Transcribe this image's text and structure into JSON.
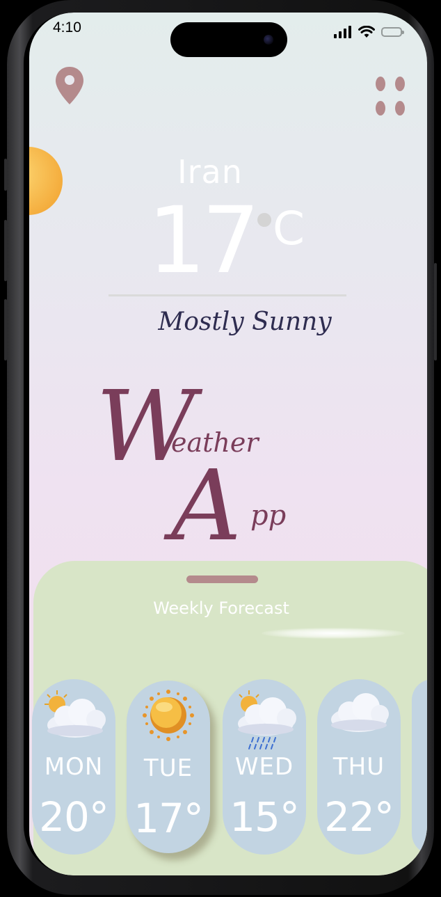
{
  "status_bar": {
    "time": "4:10"
  },
  "location": {
    "country": "Iran",
    "temperature": "17",
    "unit": "C",
    "condition": "Mostly Sunny"
  },
  "branding": {
    "title_line1_cap": "W",
    "title_line1_rest": "eather",
    "title_line2_cap": "A",
    "title_line2_rest": "pp"
  },
  "forecast": {
    "title": "Weekly Forecast",
    "days": [
      {
        "day": "MON",
        "temp": "20°",
        "icon": "partly-cloudy-icon"
      },
      {
        "day": "TUE",
        "temp": "17°",
        "icon": "sun-icon"
      },
      {
        "day": "WED",
        "temp": "15°",
        "icon": "rain-icon"
      },
      {
        "day": "THU",
        "temp": "22°",
        "icon": "cloud-icon"
      }
    ]
  },
  "colors": {
    "accent": "#b48a8c",
    "title": "#7a3d5a",
    "condition_text": "#2e2c50",
    "sheet_bg": "#d8e5c7",
    "card_bg": "#c2d4e2",
    "sun": "#f4ac3c"
  }
}
